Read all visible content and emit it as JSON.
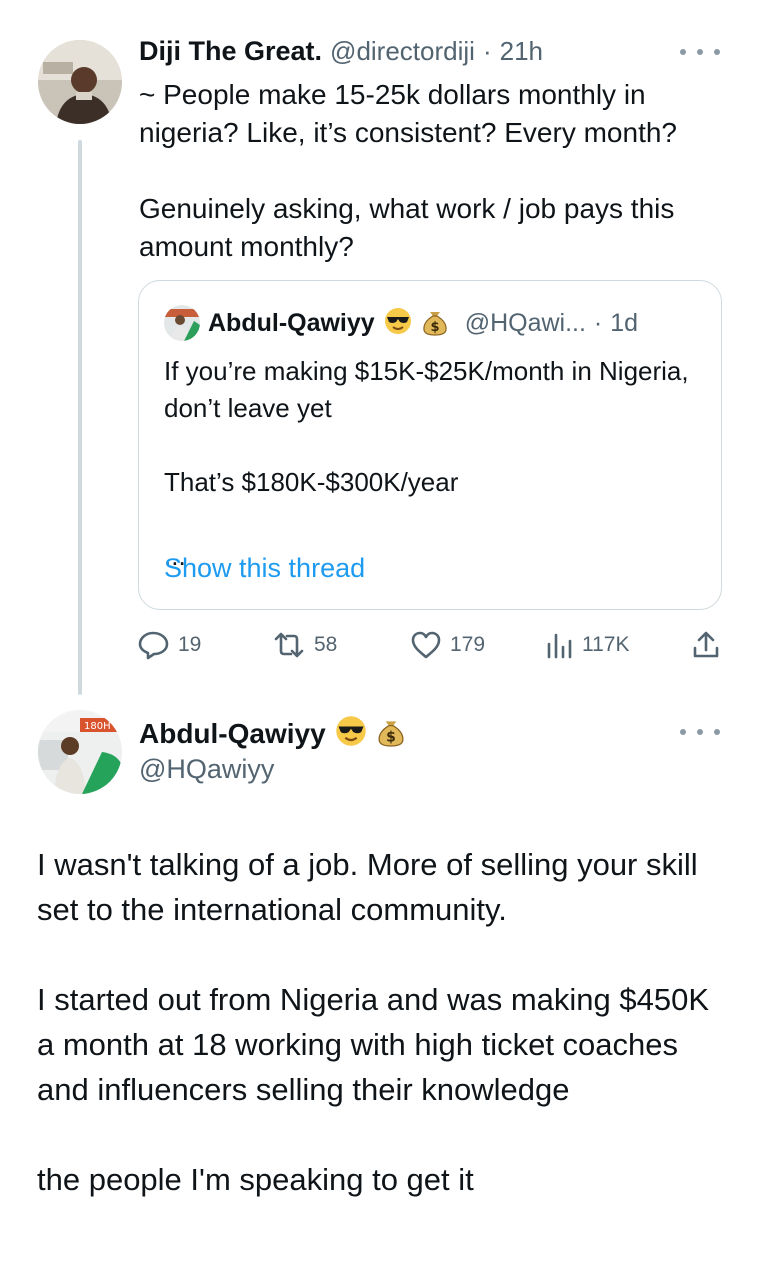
{
  "tweet1": {
    "author_name": "Diji The Great.",
    "handle": "@directordiji",
    "separator": "·",
    "time": "21h",
    "text": "~ People make 15-25k dollars monthly in nigeria? Like, it’s consistent? Every month?\n\nGenuinely asking, what work / job pays this amount monthly?"
  },
  "quote": {
    "author_name": "Abdul-Qawiyy",
    "handle": "@HQawi...",
    "separator": "·",
    "time": "1d",
    "text": "If you’re making $15K-$25K/month in Nigeria, don’t leave yet\n\nThat’s $180K-$300K/year\n\n...",
    "show_thread": "Show this thread"
  },
  "actions": {
    "replies": "19",
    "retweets": "58",
    "likes": "179",
    "views": "117K"
  },
  "tweet2": {
    "author_name": "Abdul-Qawiyy",
    "handle": "@HQawiyy",
    "text": "I wasn't talking of a job. More of selling your skill set to the international community.\n\nI started out from Nigeria and was making $450K a month at 18 working with high ticket coaches and influencers selling their knowledge\n\nthe people I'm speaking to get it"
  },
  "icons": {
    "reply": "reply-icon",
    "retweet": "retweet-icon",
    "like": "heart-icon",
    "views": "views-icon",
    "share": "share-icon",
    "more": "more-icon",
    "emoji1": "sunglasses-emoji",
    "emoji2": "money-bag-emoji"
  },
  "colors": {
    "link": "#1d9bf0",
    "muted": "#536471",
    "border": "#cfd9de",
    "text": "#0f1419"
  }
}
